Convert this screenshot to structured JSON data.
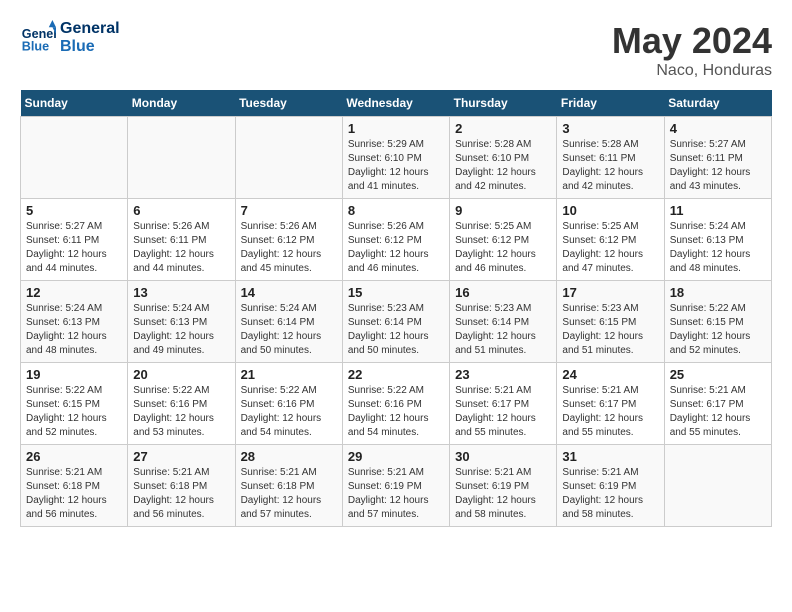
{
  "header": {
    "logo_line1": "General",
    "logo_line2": "Blue",
    "month_year": "May 2024",
    "location": "Naco, Honduras"
  },
  "weekdays": [
    "Sunday",
    "Monday",
    "Tuesday",
    "Wednesday",
    "Thursday",
    "Friday",
    "Saturday"
  ],
  "weeks": [
    [
      {
        "day": "",
        "info": ""
      },
      {
        "day": "",
        "info": ""
      },
      {
        "day": "",
        "info": ""
      },
      {
        "day": "1",
        "info": "Sunrise: 5:29 AM\nSunset: 6:10 PM\nDaylight: 12 hours\nand 41 minutes."
      },
      {
        "day": "2",
        "info": "Sunrise: 5:28 AM\nSunset: 6:10 PM\nDaylight: 12 hours\nand 42 minutes."
      },
      {
        "day": "3",
        "info": "Sunrise: 5:28 AM\nSunset: 6:11 PM\nDaylight: 12 hours\nand 42 minutes."
      },
      {
        "day": "4",
        "info": "Sunrise: 5:27 AM\nSunset: 6:11 PM\nDaylight: 12 hours\nand 43 minutes."
      }
    ],
    [
      {
        "day": "5",
        "info": "Sunrise: 5:27 AM\nSunset: 6:11 PM\nDaylight: 12 hours\nand 44 minutes."
      },
      {
        "day": "6",
        "info": "Sunrise: 5:26 AM\nSunset: 6:11 PM\nDaylight: 12 hours\nand 44 minutes."
      },
      {
        "day": "7",
        "info": "Sunrise: 5:26 AM\nSunset: 6:12 PM\nDaylight: 12 hours\nand 45 minutes."
      },
      {
        "day": "8",
        "info": "Sunrise: 5:26 AM\nSunset: 6:12 PM\nDaylight: 12 hours\nand 46 minutes."
      },
      {
        "day": "9",
        "info": "Sunrise: 5:25 AM\nSunset: 6:12 PM\nDaylight: 12 hours\nand 46 minutes."
      },
      {
        "day": "10",
        "info": "Sunrise: 5:25 AM\nSunset: 6:12 PM\nDaylight: 12 hours\nand 47 minutes."
      },
      {
        "day": "11",
        "info": "Sunrise: 5:24 AM\nSunset: 6:13 PM\nDaylight: 12 hours\nand 48 minutes."
      }
    ],
    [
      {
        "day": "12",
        "info": "Sunrise: 5:24 AM\nSunset: 6:13 PM\nDaylight: 12 hours\nand 48 minutes."
      },
      {
        "day": "13",
        "info": "Sunrise: 5:24 AM\nSunset: 6:13 PM\nDaylight: 12 hours\nand 49 minutes."
      },
      {
        "day": "14",
        "info": "Sunrise: 5:24 AM\nSunset: 6:14 PM\nDaylight: 12 hours\nand 50 minutes."
      },
      {
        "day": "15",
        "info": "Sunrise: 5:23 AM\nSunset: 6:14 PM\nDaylight: 12 hours\nand 50 minutes."
      },
      {
        "day": "16",
        "info": "Sunrise: 5:23 AM\nSunset: 6:14 PM\nDaylight: 12 hours\nand 51 minutes."
      },
      {
        "day": "17",
        "info": "Sunrise: 5:23 AM\nSunset: 6:15 PM\nDaylight: 12 hours\nand 51 minutes."
      },
      {
        "day": "18",
        "info": "Sunrise: 5:22 AM\nSunset: 6:15 PM\nDaylight: 12 hours\nand 52 minutes."
      }
    ],
    [
      {
        "day": "19",
        "info": "Sunrise: 5:22 AM\nSunset: 6:15 PM\nDaylight: 12 hours\nand 52 minutes."
      },
      {
        "day": "20",
        "info": "Sunrise: 5:22 AM\nSunset: 6:16 PM\nDaylight: 12 hours\nand 53 minutes."
      },
      {
        "day": "21",
        "info": "Sunrise: 5:22 AM\nSunset: 6:16 PM\nDaylight: 12 hours\nand 54 minutes."
      },
      {
        "day": "22",
        "info": "Sunrise: 5:22 AM\nSunset: 6:16 PM\nDaylight: 12 hours\nand 54 minutes."
      },
      {
        "day": "23",
        "info": "Sunrise: 5:21 AM\nSunset: 6:17 PM\nDaylight: 12 hours\nand 55 minutes."
      },
      {
        "day": "24",
        "info": "Sunrise: 5:21 AM\nSunset: 6:17 PM\nDaylight: 12 hours\nand 55 minutes."
      },
      {
        "day": "25",
        "info": "Sunrise: 5:21 AM\nSunset: 6:17 PM\nDaylight: 12 hours\nand 55 minutes."
      }
    ],
    [
      {
        "day": "26",
        "info": "Sunrise: 5:21 AM\nSunset: 6:18 PM\nDaylight: 12 hours\nand 56 minutes."
      },
      {
        "day": "27",
        "info": "Sunrise: 5:21 AM\nSunset: 6:18 PM\nDaylight: 12 hours\nand 56 minutes."
      },
      {
        "day": "28",
        "info": "Sunrise: 5:21 AM\nSunset: 6:18 PM\nDaylight: 12 hours\nand 57 minutes."
      },
      {
        "day": "29",
        "info": "Sunrise: 5:21 AM\nSunset: 6:19 PM\nDaylight: 12 hours\nand 57 minutes."
      },
      {
        "day": "30",
        "info": "Sunrise: 5:21 AM\nSunset: 6:19 PM\nDaylight: 12 hours\nand 58 minutes."
      },
      {
        "day": "31",
        "info": "Sunrise: 5:21 AM\nSunset: 6:19 PM\nDaylight: 12 hours\nand 58 minutes."
      },
      {
        "day": "",
        "info": ""
      }
    ]
  ]
}
